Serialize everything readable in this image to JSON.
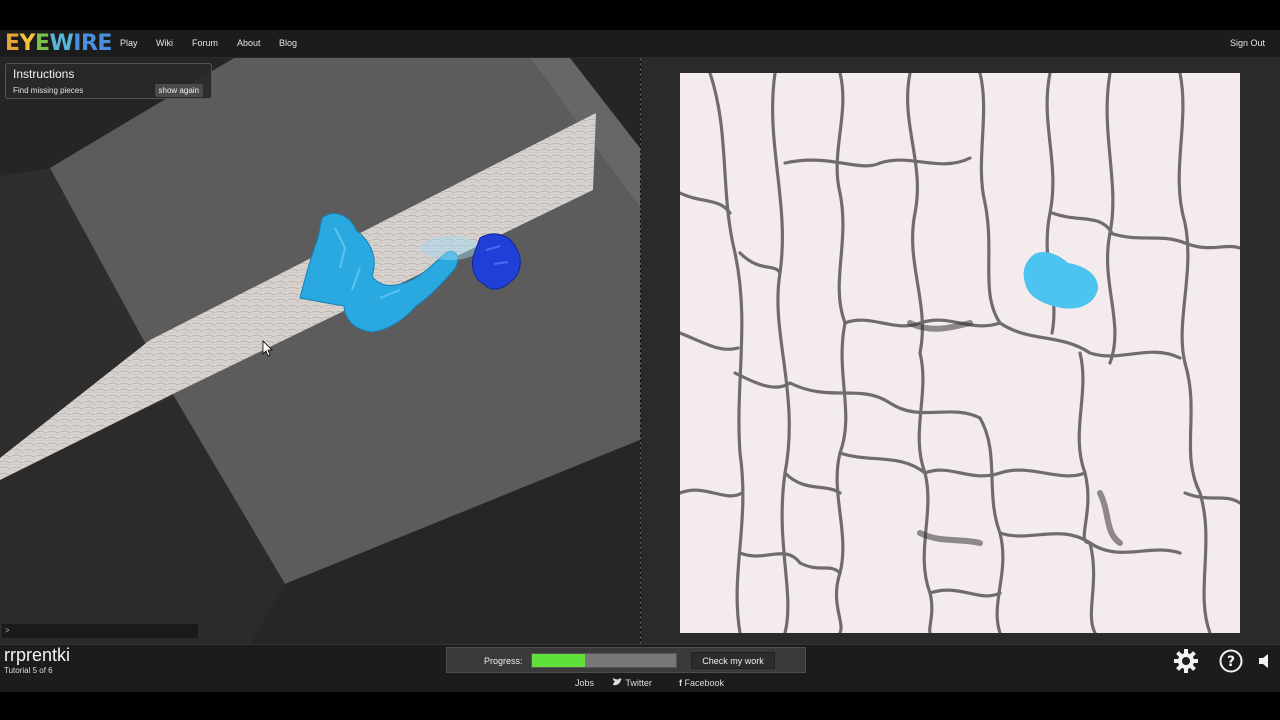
{
  "header": {
    "logo_parts": [
      "E",
      "Y",
      "E",
      "W",
      "IRE"
    ],
    "nav": [
      {
        "label": "Play"
      },
      {
        "label": "Wiki"
      },
      {
        "label": "Forum"
      },
      {
        "label": "About"
      },
      {
        "label": "Blog"
      }
    ],
    "sign_out": "Sign Out"
  },
  "instructions": {
    "title": "Instructions",
    "text": "Find missing pieces",
    "button": "show again"
  },
  "console": {
    "prompt": ">"
  },
  "status": {
    "username": "rrprentki",
    "tutorial": "Tutorial 5 of 6"
  },
  "progress": {
    "label": "Progress:",
    "value_fraction": 0.37,
    "fill_color": "#5fe03a",
    "button": "Check my work"
  },
  "icons": [
    "gear-icon",
    "help-icon",
    "speaker-icon",
    "twitter-icon",
    "facebook-icon"
  ],
  "footer": {
    "jobs": "Jobs",
    "twitter": "Twitter",
    "facebook": "Facebook"
  },
  "colors": {
    "segment_light": "#2aa8e0",
    "segment_dark": "#1f3fd6",
    "selection_2d": "#4dc3f0"
  }
}
